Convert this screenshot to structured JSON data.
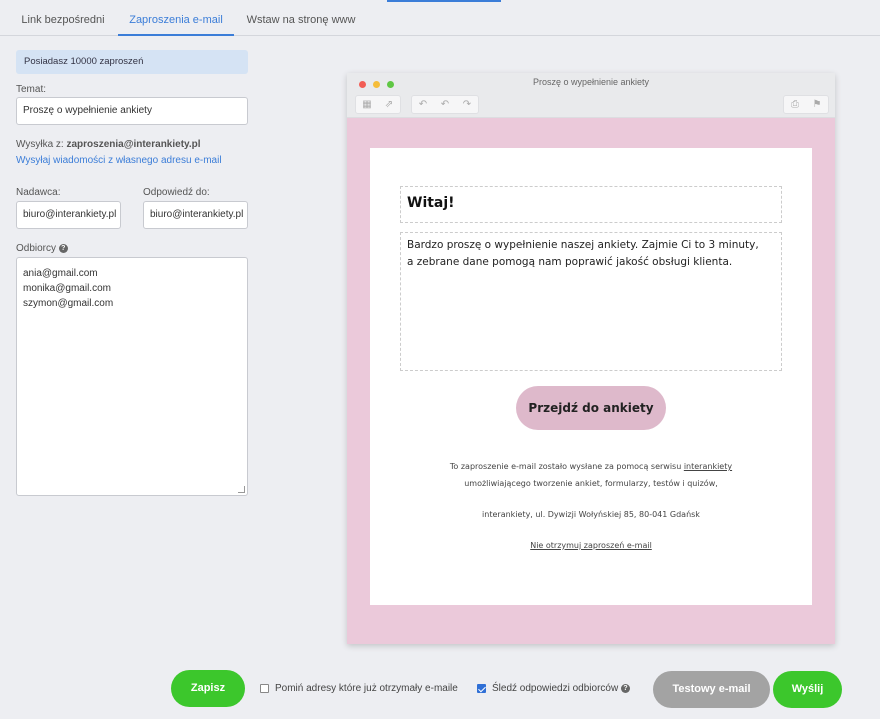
{
  "tabs": [
    {
      "label": "Link bezpośredni"
    },
    {
      "label": "Zaproszenia e-mail"
    },
    {
      "label": "Wstaw na stronę www"
    }
  ],
  "left": {
    "invites_info": "Posiadasz 10000 zaproszeń",
    "subject_label": "Temat:",
    "subject_value": "Proszę o wypełnienie ankiety",
    "sent_from_label": "Wysyłka z: ",
    "sent_from_value": "zaproszenia@interankiety.pl",
    "own_address_link": "Wysyłaj wiadomości z własnego adresu e-mail",
    "sender_label": "Nadawca:",
    "sender_value": "biuro@interankiety.pl",
    "reply_to_label": "Odpowiedź do:",
    "reply_to_value": "biuro@interankiety.pl",
    "recipients_label": "Odbiorcy",
    "recipients": [
      "ania@gmail.com",
      "monika@gmail.com",
      "szymon@gmail.com"
    ]
  },
  "preview": {
    "window_title": "Proszę o wypełnienie ankiety",
    "heading": "Witaj!",
    "body_line1": "Bardzo proszę o wypełnienie naszej ankiety. Zajmie Ci to 3 minuty,",
    "body_line2": "a zebrane dane pomogą nam poprawić jakość obsługi klienta.",
    "cta": "Przejdź do ankiety",
    "footer_line1_pre": "To zaproszenie e-mail zostało wysłane za pomocą serwisu ",
    "footer_line1_link": "interankiety",
    "footer_line2": "umożliwiającego tworzenie ankiet, formularzy, testów i quizów,",
    "footer_address": "interankiety, ul. Dywizji Wołyńskiej 85, 80-041 Gdańsk",
    "unsubscribe": "Nie otrzymuj zaproszeń e-mail"
  },
  "actions": {
    "save": "Zapisz",
    "skip_label": "Pomiń adresy które już otrzymały e-maile",
    "skip_checked": false,
    "track_label": "Śledź odpowiedzi odbiorców",
    "track_checked": true,
    "test_email": "Testowy e-mail",
    "send": "Wyślij"
  },
  "colors": {
    "accent": "#3b7dd8",
    "green": "#3cc72c",
    "gray_button": "#a3a3a3",
    "mail_background": "#ebc9da",
    "cta_background": "#deb9cb"
  },
  "icons": {
    "traffic_lights": [
      "close-dot",
      "minimize-dot",
      "zoom-dot"
    ],
    "toolbar": [
      "trash-icon",
      "move-icon",
      "reply-icon",
      "reply-all-icon",
      "forward-icon",
      "print-icon",
      "flag-icon"
    ]
  }
}
